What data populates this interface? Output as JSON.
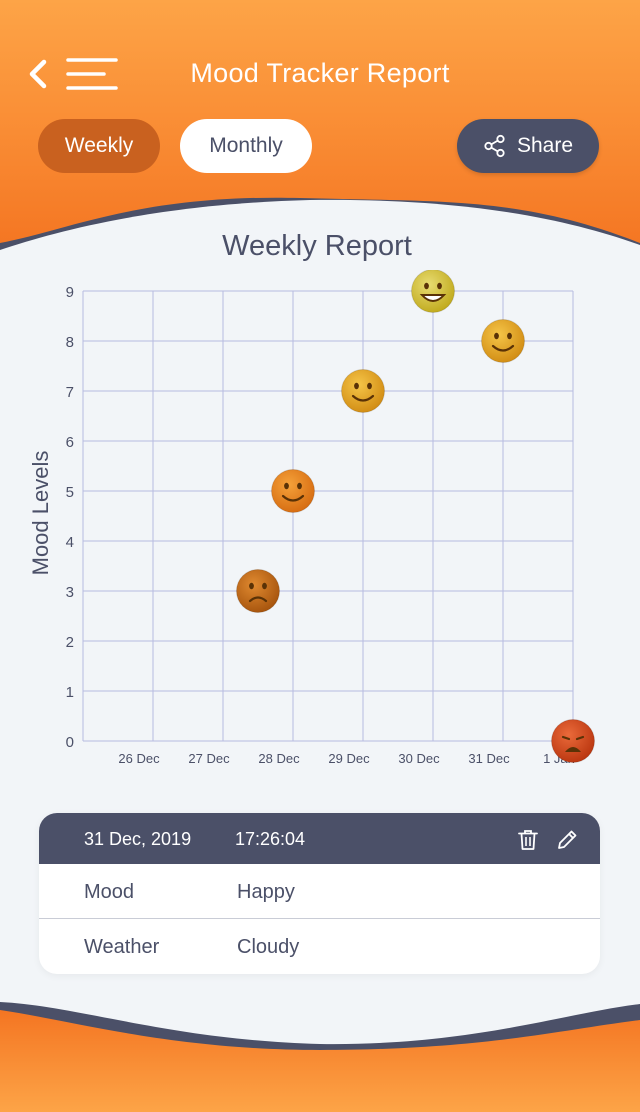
{
  "header": {
    "title": "Mood Tracker Report",
    "tabs": [
      {
        "label": "Weekly",
        "selected": true
      },
      {
        "label": "Monthly",
        "selected": false
      }
    ],
    "share_label": "Share"
  },
  "colors": {
    "brand_orange": "#f98b33",
    "selected_tab": "#c9611f",
    "slate": "#4b5068",
    "background": "#f2f5f8"
  },
  "chart_data": {
    "type": "scatter",
    "title": "Weekly Report",
    "xlabel": "",
    "ylabel": "Mood Levels",
    "x_ticks": [
      "26 Dec",
      "27 Dec",
      "28 Dec",
      "29 Dec",
      "30 Dec",
      "31 Dec",
      "1 Jan"
    ],
    "y_ticks": [
      "0",
      "1",
      "2",
      "3",
      "4",
      "5",
      "6",
      "7",
      "8",
      "9"
    ],
    "ylim": [
      0,
      9
    ],
    "grid": true,
    "points": [
      {
        "x": "27 Dec",
        "x_offset": 0.5,
        "y": 3,
        "mood_icon": "frowning-face"
      },
      {
        "x": "28 Dec",
        "x_offset": 0,
        "y": 5,
        "mood_icon": "slightly-smiling-face"
      },
      {
        "x": "29 Dec",
        "x_offset": 0,
        "y": 7,
        "mood_icon": "smiling-face"
      },
      {
        "x": "30 Dec",
        "x_offset": 0,
        "y": 9,
        "mood_icon": "grinning-face"
      },
      {
        "x": "31 Dec",
        "x_offset": 0,
        "y": 8,
        "mood_icon": "smiling-face"
      },
      {
        "x": "1 Jan",
        "x_offset": 0,
        "y": 0,
        "mood_icon": "weary-face"
      }
    ]
  },
  "entry": {
    "date": "31 Dec, 2019",
    "time": "17:26:04",
    "rows": [
      {
        "label": "Mood",
        "value": "Happy"
      },
      {
        "label": "Weather",
        "value": "Cloudy"
      }
    ]
  }
}
